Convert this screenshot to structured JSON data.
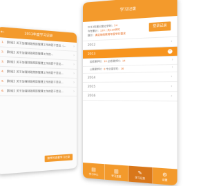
{
  "left_phone": {
    "back_icon": "back-arrow-icon",
    "title": "2013年度学习记录",
    "items": [
      {
        "num": "1.",
        "text": "【财经】关于加强财政预算管理工作的若干意见（..."
      },
      {
        "num": "2.",
        "text": "【财经】关于加强财政预算管理工作的..."
      },
      {
        "num": "3.",
        "text": "【财经】关于加强财政预算管理工作的若干意见..."
      },
      {
        "num": "4.",
        "text": "【财经】关于加强财政预算管理工作的若干意见..."
      },
      {
        "num": "5.",
        "text": "【财经】关于加强财政预算管理工作的若干意见..."
      },
      {
        "num": "6.",
        "text": "【财经】关于加强财政预算管理工作的若干意见..."
      }
    ],
    "button_label": "按学时查看学习记录"
  },
  "right_phone": {
    "title": "学习记录",
    "info": {
      "line1_label": "2013年度已登记学时：",
      "line1_value": "24",
      "line2_label": "今年累计：",
      "line2_value": "120 / 共120学时",
      "line3_label": "提示：",
      "line3_value": "满足继续教育年度学时要求"
    },
    "record_button": "登录记录",
    "years": [
      {
        "label": "2012",
        "active": false
      },
      {
        "label": "2013",
        "active": true
      }
    ],
    "detail_rows": [
      {
        "l1": "选修课学时：",
        "v1": "10",
        "l2": "必修课学时：",
        "v2": "14"
      },
      {
        "l1": "公需课学时：",
        "v1": "8",
        "l2": "专业课学时：",
        "v2": "16"
      }
    ],
    "more_years": [
      {
        "label": "2014"
      },
      {
        "label": "2015"
      },
      {
        "label": "2016"
      }
    ],
    "nav": [
      {
        "label": "学习中心",
        "icon": "book-icon",
        "active": false
      },
      {
        "label": "学习进度",
        "icon": "chart-icon",
        "active": false
      },
      {
        "label": "学习记录",
        "icon": "pencil-icon",
        "active": true
      },
      {
        "label": "设置",
        "icon": "gear-icon",
        "active": false
      }
    ]
  }
}
